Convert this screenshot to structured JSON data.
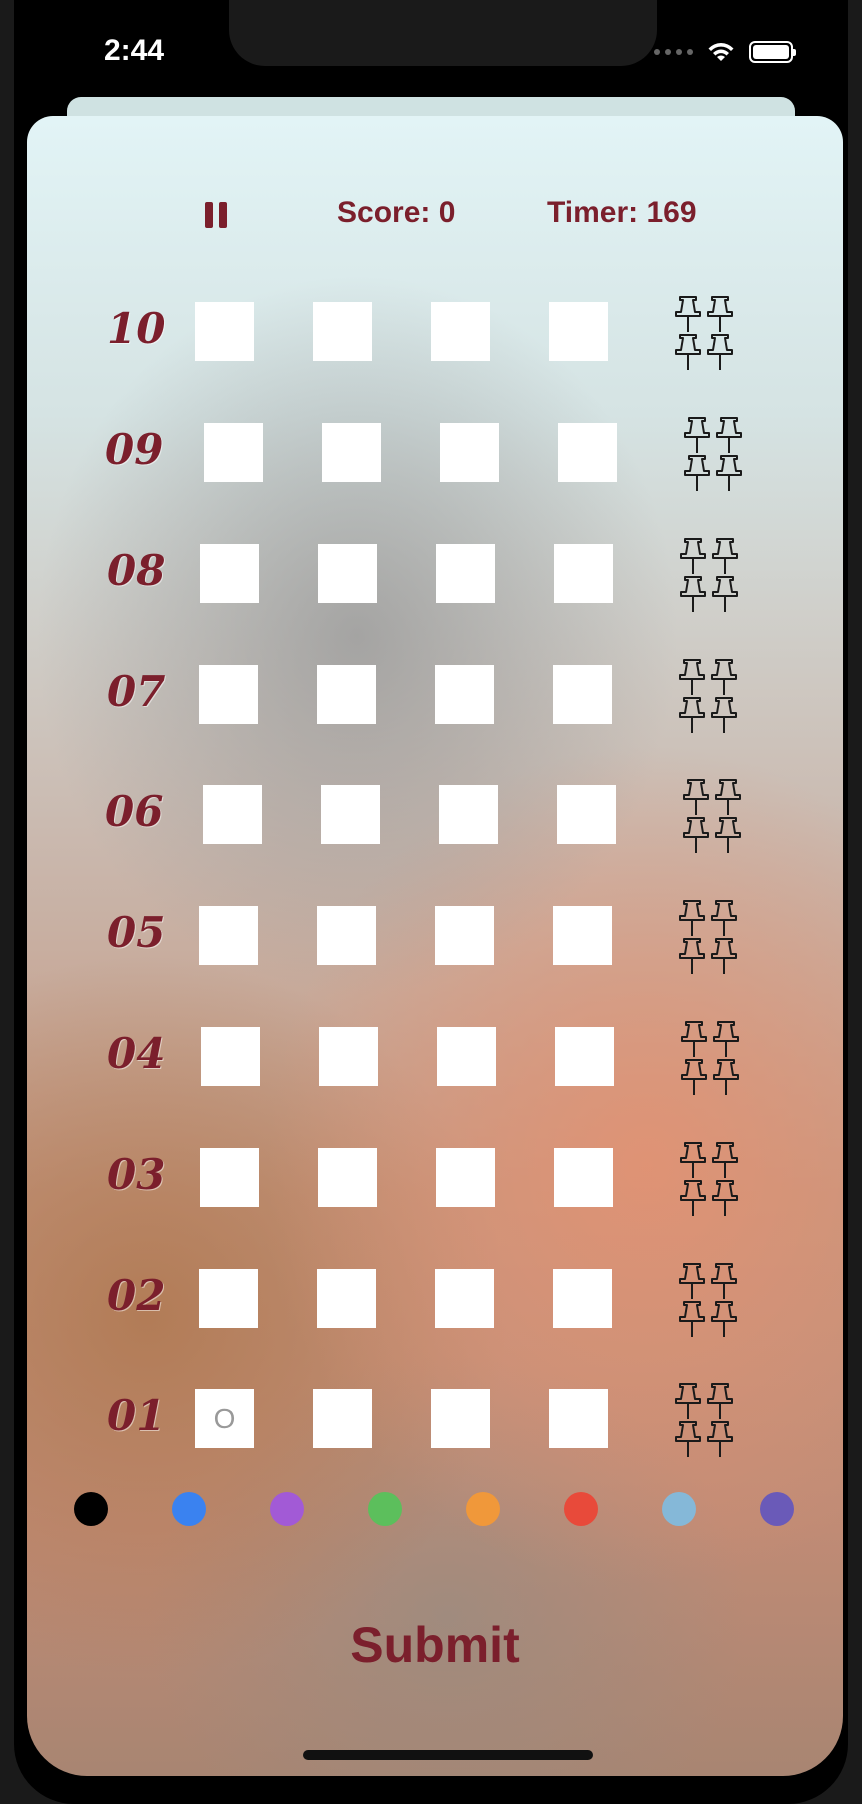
{
  "status_bar": {
    "time": "2:44",
    "icons": [
      "cellular-dots-icon",
      "wifi-icon",
      "battery-icon"
    ]
  },
  "header": {
    "pause_icon": "pause-icon",
    "score_label": "Score:",
    "score_value": "0",
    "timer_label": "Timer:",
    "timer_value": "169"
  },
  "rows": [
    {
      "number": "10",
      "slots": [
        "",
        "",
        "",
        ""
      ]
    },
    {
      "number": "09",
      "slots": [
        "",
        "",
        "",
        ""
      ]
    },
    {
      "number": "08",
      "slots": [
        "",
        "",
        "",
        ""
      ]
    },
    {
      "number": "07",
      "slots": [
        "",
        "",
        "",
        ""
      ]
    },
    {
      "number": "06",
      "slots": [
        "",
        "",
        "",
        ""
      ]
    },
    {
      "number": "05",
      "slots": [
        "",
        "",
        "",
        ""
      ]
    },
    {
      "number": "04",
      "slots": [
        "",
        "",
        "",
        ""
      ]
    },
    {
      "number": "03",
      "slots": [
        "",
        "",
        "",
        ""
      ]
    },
    {
      "number": "02",
      "slots": [
        "",
        "",
        "",
        ""
      ]
    },
    {
      "number": "01",
      "slots": [
        "O",
        "",
        "",
        ""
      ]
    }
  ],
  "palette": [
    {
      "name": "black",
      "color": "#000000"
    },
    {
      "name": "blue",
      "color": "#3a82f0"
    },
    {
      "name": "purple",
      "color": "#a25ad6"
    },
    {
      "name": "green",
      "color": "#5cbf5c"
    },
    {
      "name": "orange",
      "color": "#f0983a"
    },
    {
      "name": "red",
      "color": "#e84a3a"
    },
    {
      "name": "light-blue",
      "color": "#85b8d8"
    },
    {
      "name": "indigo",
      "color": "#6a5ab8"
    }
  ],
  "submit_label": "Submit",
  "colors": {
    "accent": "#7b1f2c"
  }
}
